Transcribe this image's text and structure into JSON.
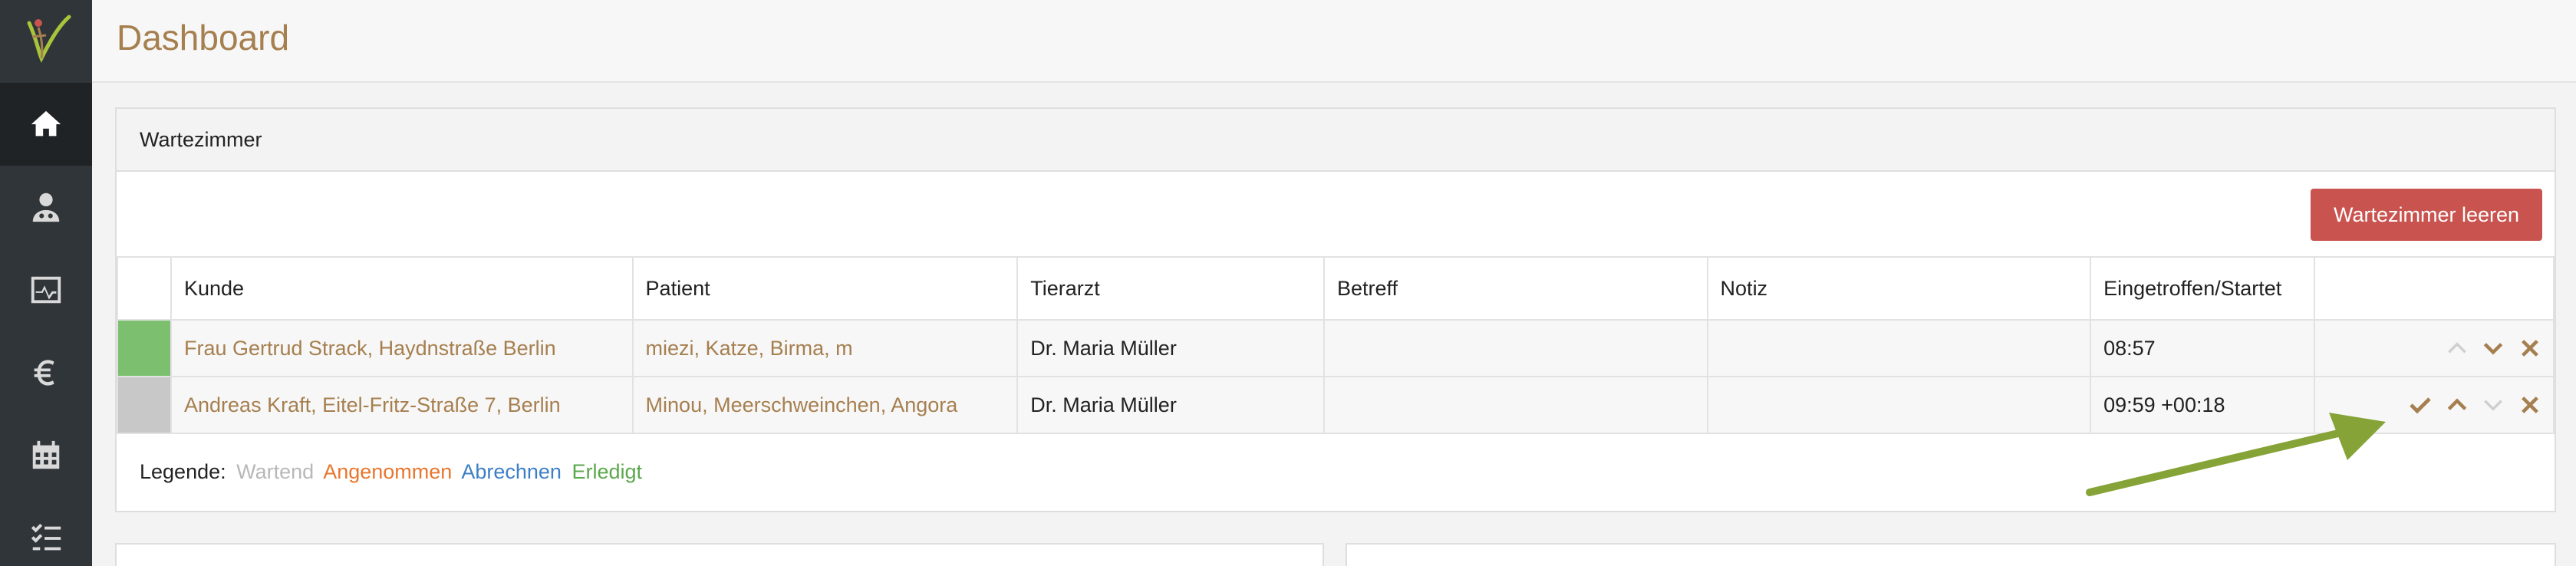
{
  "header": {
    "title": "Dashboard"
  },
  "sidebar": {
    "items": [
      {
        "name": "home",
        "icon": "home-icon",
        "active": true
      },
      {
        "name": "doctor",
        "icon": "doctor-icon",
        "active": false
      },
      {
        "name": "monitor",
        "icon": "monitor-chart-icon",
        "active": false
      },
      {
        "name": "billing",
        "icon": "euro-icon",
        "active": false
      },
      {
        "name": "calendar",
        "icon": "calendar-icon",
        "active": false
      },
      {
        "name": "tasks",
        "icon": "checklist-icon",
        "active": false
      }
    ]
  },
  "waiting_room": {
    "title": "Wartezimmer",
    "clear_button": "Wartezimmer leeren",
    "columns": [
      "Kunde",
      "Patient",
      "Tierarzt",
      "Betreff",
      "Notiz",
      "Eingetroffen/Startet"
    ],
    "rows": [
      {
        "status_color": "#7cc06f",
        "customer": "Frau Gertrud Strack, Haydnstraße Berlin",
        "patient": "miezi, Katze, Birma, m",
        "vet": "Dr. Maria Müller",
        "subject": "",
        "note": "",
        "time": "08:57",
        "actions": [
          "chevron-up-icon",
          "chevron-down-icon",
          "close-icon"
        ]
      },
      {
        "status_color": "#c8c8c8",
        "customer": "Andreas Kraft, Eitel-Fritz-Straße 7, Berlin",
        "patient": "Minou, Meerschweinchen, Angora",
        "vet": "Dr. Maria Müller",
        "subject": "",
        "note": "",
        "time": "09:59  +00:18",
        "actions": [
          "check-icon",
          "chevron-up-icon",
          "chevron-down-icon",
          "close-icon"
        ]
      }
    ],
    "legend": {
      "label": "Legende:",
      "items": [
        {
          "text": "Wartend",
          "color": "#b8b8b8"
        },
        {
          "text": "Angenommen",
          "color": "#e8772e"
        },
        {
          "text": "Abrechnen",
          "color": "#3d7fc6"
        },
        {
          "text": "Erledigt",
          "color": "#5aa84c"
        }
      ]
    }
  },
  "colors": {
    "accent": "#a67f4f",
    "danger": "#c9534f",
    "sidebar": "#2f3539",
    "annotation_arrow": "#86a337"
  }
}
